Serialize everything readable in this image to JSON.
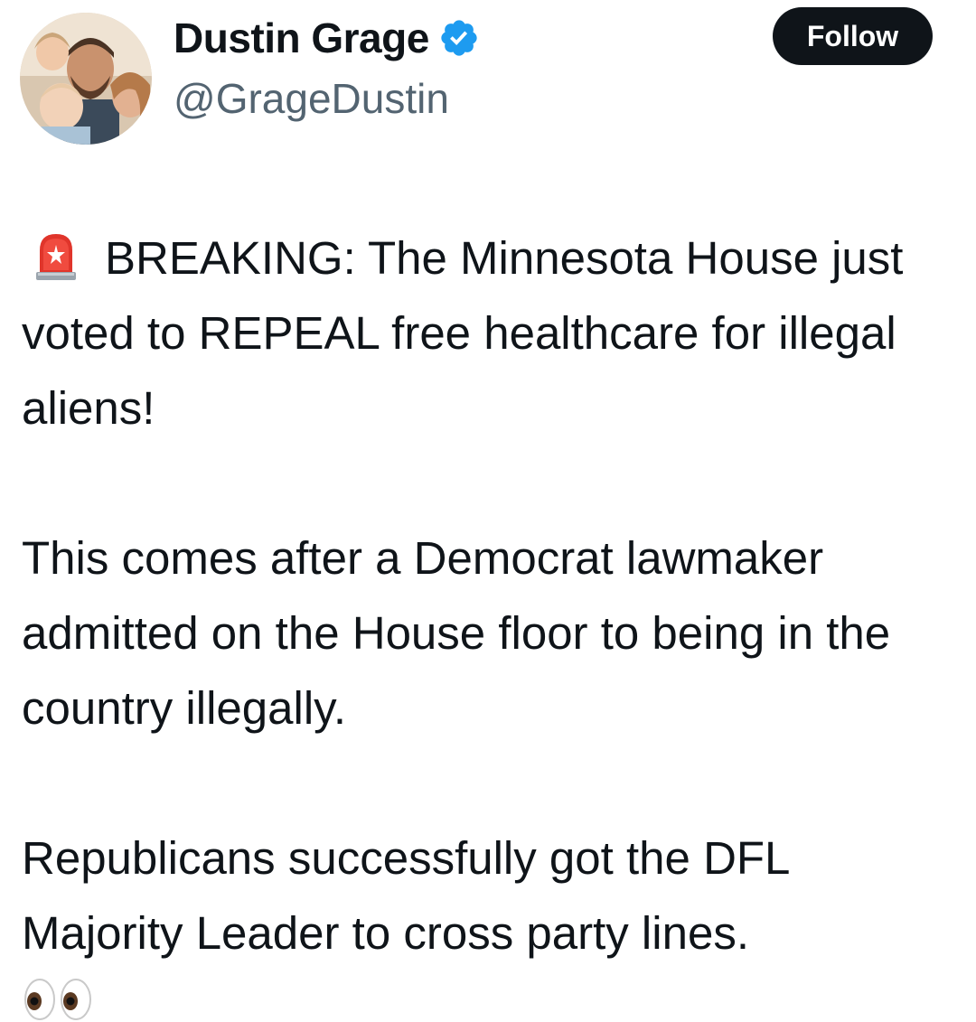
{
  "author": {
    "display_name": "Dustin Grage",
    "handle": "@GrageDustin",
    "verified": true,
    "avatar": "family-photo-avatar"
  },
  "follow_button": {
    "label": "Follow"
  },
  "tweet": {
    "leading_icon": "police-siren-emoji",
    "paragraphs": [
      "BREAKING: The Minnesota House just voted to REPEAL free healthcare for illegal aliens!",
      "This comes after a Democrat lawmaker admitted on the House floor to being in the country illegally.",
      "Republicans successfully got the DFL Majority Leader to cross party lines."
    ],
    "trailing_icon": "eyes-emoji"
  },
  "colors": {
    "text": "#0f1419",
    "secondary_text": "#536471",
    "verified_blue": "#1d9bf0",
    "follow_button_bg": "#0f1419",
    "follow_button_text": "#ffffff"
  }
}
